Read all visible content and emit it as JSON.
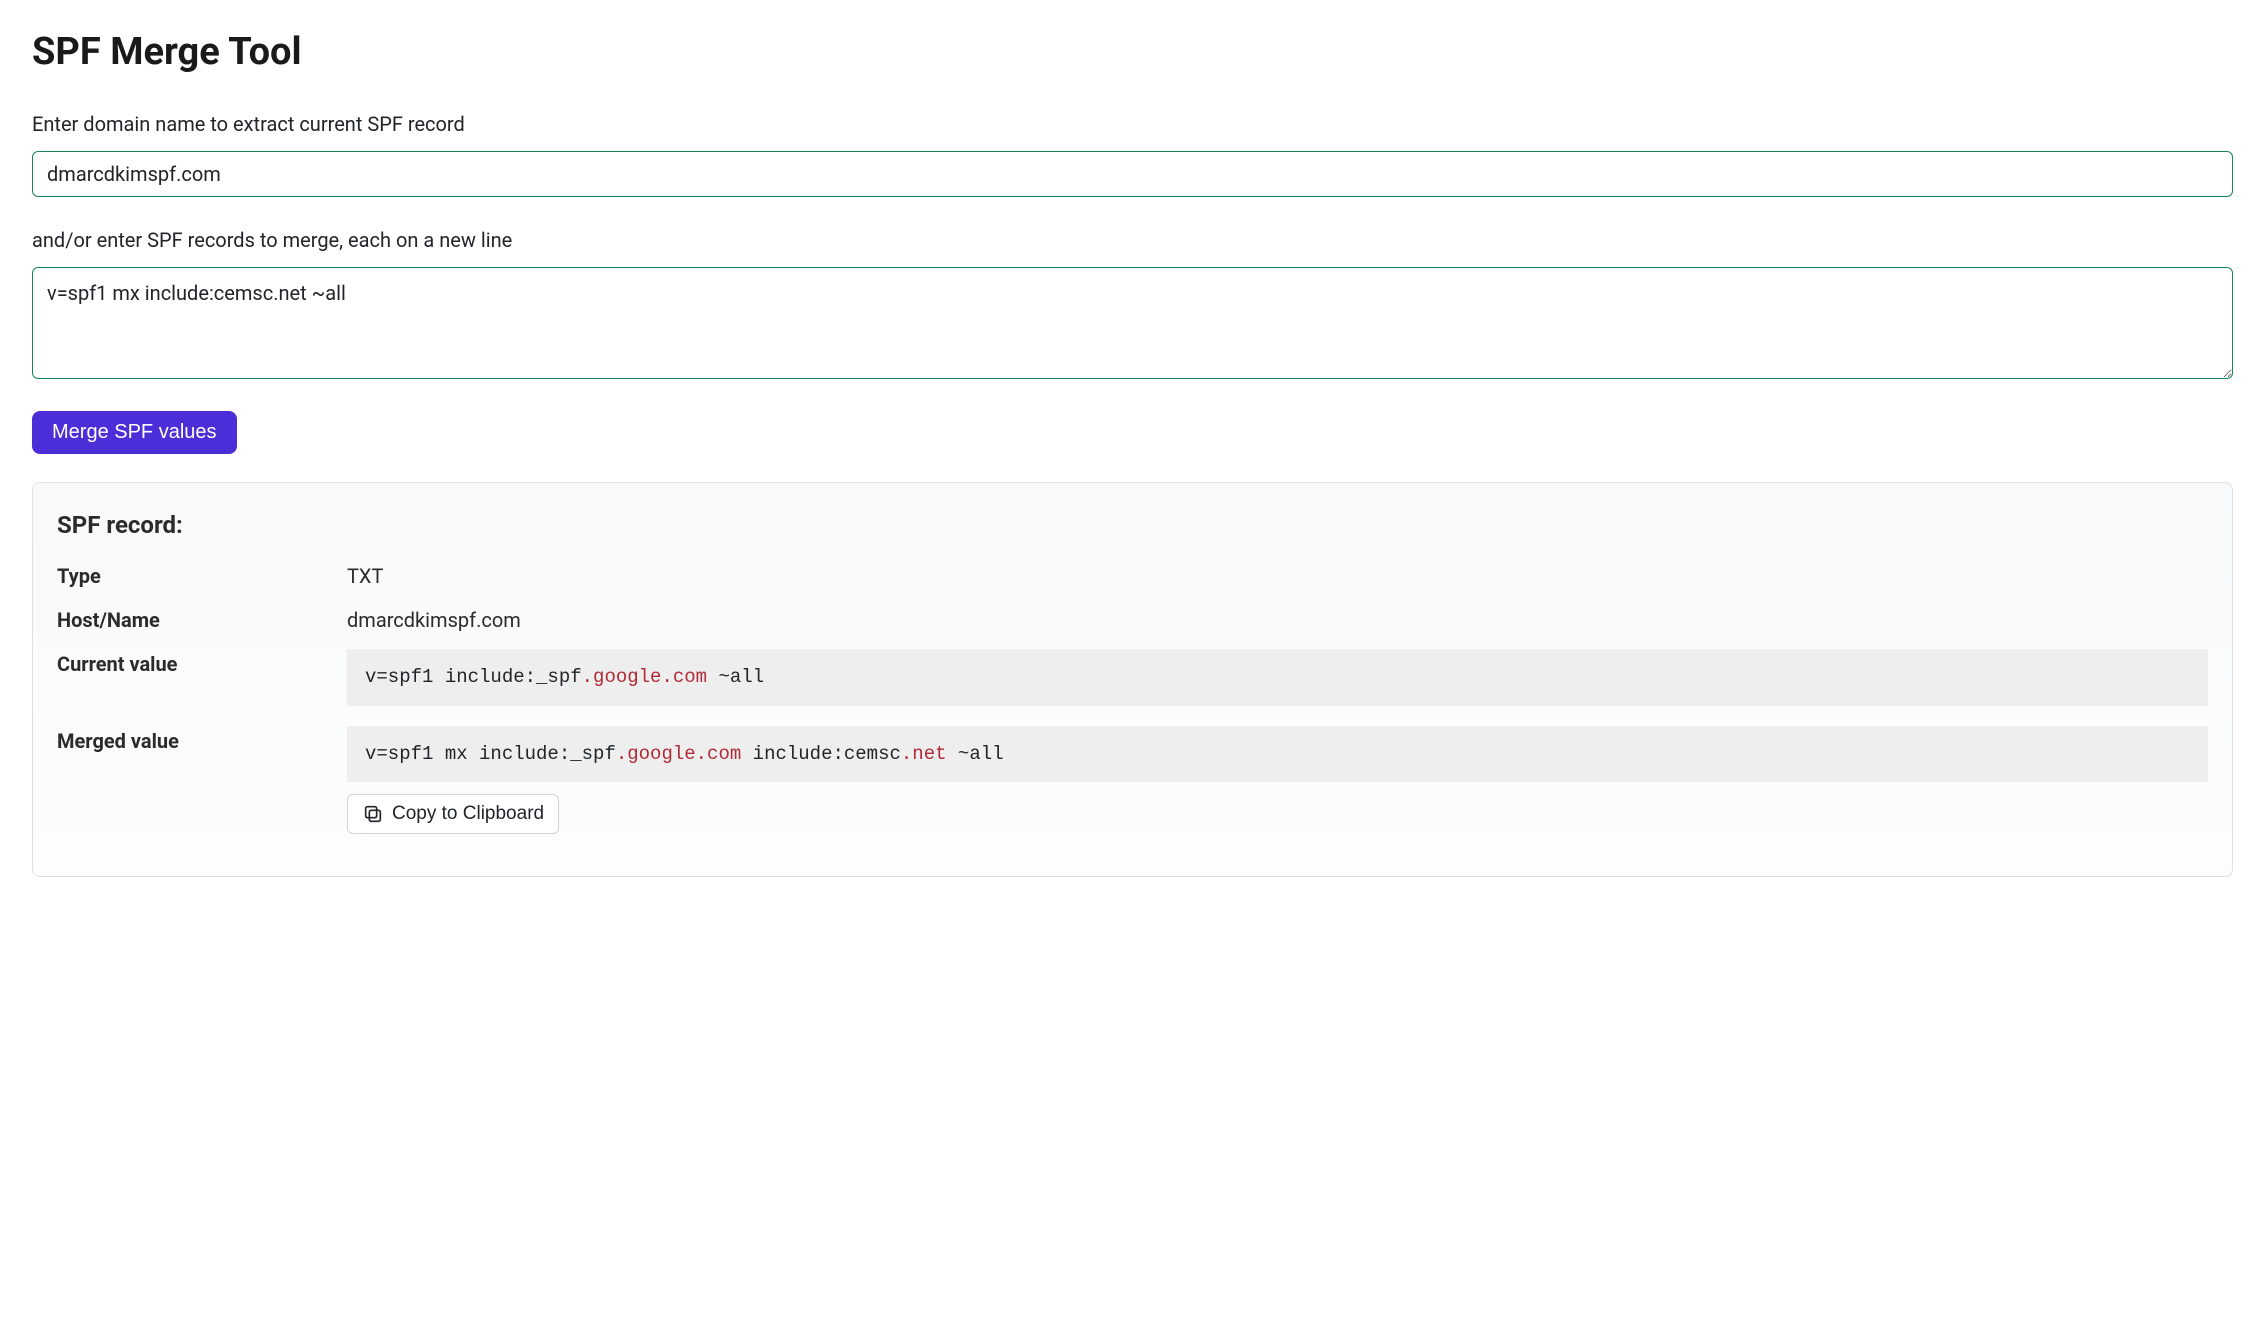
{
  "page": {
    "title": "SPF Merge Tool"
  },
  "form": {
    "domain_label": "Enter domain name to extract current SPF record",
    "domain_value": "dmarcdkimspf.com",
    "domain_placeholder": "",
    "records_label": "and/or enter SPF records to merge, each on a new line",
    "records_value": "v=spf1 mx include:cemsc.net ~all",
    "records_placeholder": "",
    "merge_button": "Merge SPF values"
  },
  "result": {
    "heading": "SPF record:",
    "rows": [
      {
        "key": "Type",
        "val": "TXT",
        "plain": true
      },
      {
        "key": "Host/Name",
        "val": "dmarcdkimspf.com",
        "plain": true
      },
      {
        "key": "Current value",
        "code_tokens": [
          {
            "t": "v=spf1 include:_spf"
          },
          {
            "t": ".google.com",
            "hl": true
          },
          {
            "t": " ~all"
          }
        ]
      },
      {
        "key": "Merged value",
        "code_tokens": [
          {
            "t": "v=spf1 mx include:_spf"
          },
          {
            "t": ".google.com",
            "hl": true
          },
          {
            "t": " include:cemsc"
          },
          {
            "t": ".net",
            "hl": true
          },
          {
            "t": " ~all"
          }
        ],
        "copy_button": "Copy to Clipboard"
      }
    ]
  }
}
